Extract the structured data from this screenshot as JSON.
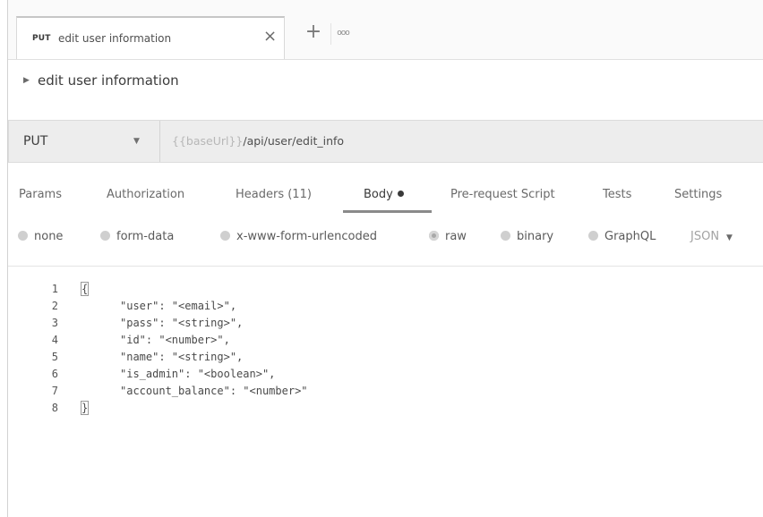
{
  "tab": {
    "method": "PUT",
    "title": "edit user information",
    "close_icon": "×",
    "new_tab_icon": "+",
    "more_icon": "ooo"
  },
  "request": {
    "name": "edit user information",
    "method": "PUT",
    "url_variable": "{{baseUrl}}",
    "url_path": "/api/user/edit_info"
  },
  "request_tabs": [
    {
      "label": "Params"
    },
    {
      "label": "Authorization"
    },
    {
      "label": "Headers (11)"
    },
    {
      "label": "Body"
    },
    {
      "label": "Pre-request Script"
    },
    {
      "label": "Tests"
    },
    {
      "label": "Settings"
    }
  ],
  "active_request_tab": "Body",
  "body_types": [
    {
      "label": "none"
    },
    {
      "label": "form-data"
    },
    {
      "label": "x-www-form-urlencoded"
    },
    {
      "label": "raw"
    },
    {
      "label": "binary"
    },
    {
      "label": "GraphQL"
    }
  ],
  "selected_body_type": "raw",
  "format": "JSON",
  "editor": {
    "line_numbers": [
      "1",
      "2",
      "3",
      "4",
      "5",
      "6",
      "7",
      "8"
    ],
    "lines": [
      "{",
      "\"user\": \"<email>\",",
      "\"pass\": \"<string>\",",
      "\"id\": \"<number>\",",
      "\"name\": \"<string>\",",
      "\"is_admin\": \"<boolean>\",",
      "\"account_balance\": \"<number>\"",
      "}"
    ]
  },
  "colors": {
    "url_bar_bg": "#ededed",
    "url_variable": "#b7b7b7",
    "active_tab_underline": "#8a8a8a"
  }
}
